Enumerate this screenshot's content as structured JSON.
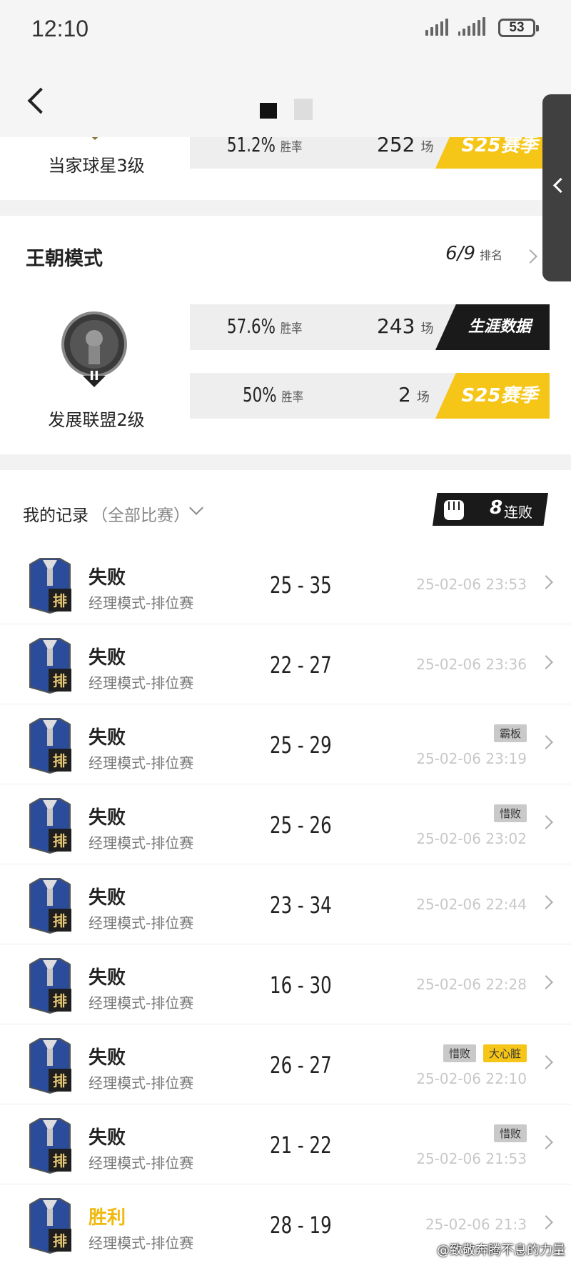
{
  "status_bar": {
    "time": "12:10",
    "battery": "53"
  },
  "career_card_top": {
    "rank_label": "当家球星3级",
    "win_rate": "51.2%",
    "win_rate_label": "胜率",
    "games": "252",
    "games_label": "场",
    "badge": "S25赛季"
  },
  "dynasty": {
    "title": "王朝模式",
    "rank": "6/9",
    "rank_label": "排名",
    "rank_level": "发展联盟2级",
    "career": {
      "win_rate": "57.6%",
      "win_rate_label": "胜率",
      "games": "243",
      "games_label": "场",
      "badge": "生涯数据"
    },
    "season": {
      "win_rate": "50%",
      "win_rate_label": "胜率",
      "games": "2",
      "games_label": "场",
      "badge": "S25赛季"
    }
  },
  "records": {
    "title": "我的记录",
    "filter": "（全部比赛）",
    "streak_count": "8",
    "streak_label": "连败",
    "matches": [
      {
        "result": "失败",
        "mode": "经理模式-排位赛",
        "score": "25 - 35",
        "time": "25-02-06 23:53",
        "tags": []
      },
      {
        "result": "失败",
        "mode": "经理模式-排位赛",
        "score": "22 - 27",
        "time": "25-02-06 23:36",
        "tags": []
      },
      {
        "result": "失败",
        "mode": "经理模式-排位赛",
        "score": "25 - 29",
        "time": "25-02-06 23:19",
        "tags": [
          "霸板"
        ]
      },
      {
        "result": "失败",
        "mode": "经理模式-排位赛",
        "score": "25 - 26",
        "time": "25-02-06 23:02",
        "tags": [
          "惜败"
        ]
      },
      {
        "result": "失败",
        "mode": "经理模式-排位赛",
        "score": "23 - 34",
        "time": "25-02-06 22:44",
        "tags": []
      },
      {
        "result": "失败",
        "mode": "经理模式-排位赛",
        "score": "16 - 30",
        "time": "25-02-06 22:28",
        "tags": []
      },
      {
        "result": "失败",
        "mode": "经理模式-排位赛",
        "score": "26 - 27",
        "time": "25-02-06 22:10",
        "tags": [
          "惜败",
          "大心脏"
        ]
      },
      {
        "result": "失败",
        "mode": "经理模式-排位赛",
        "score": "21 - 22",
        "time": "25-02-06 21:53",
        "tags": [
          "惜败"
        ]
      },
      {
        "result": "胜利",
        "mode": "经理模式-排位赛",
        "score": "28 - 19",
        "time": "25-02-06 21:3",
        "tags": []
      }
    ],
    "match_icon_label": "排"
  },
  "watermark": "@致敬奔腾不息的力量",
  "colors": {
    "accent_yellow": "#f5c517",
    "dark": "#1a1a1a",
    "win": "#f0b90b"
  }
}
